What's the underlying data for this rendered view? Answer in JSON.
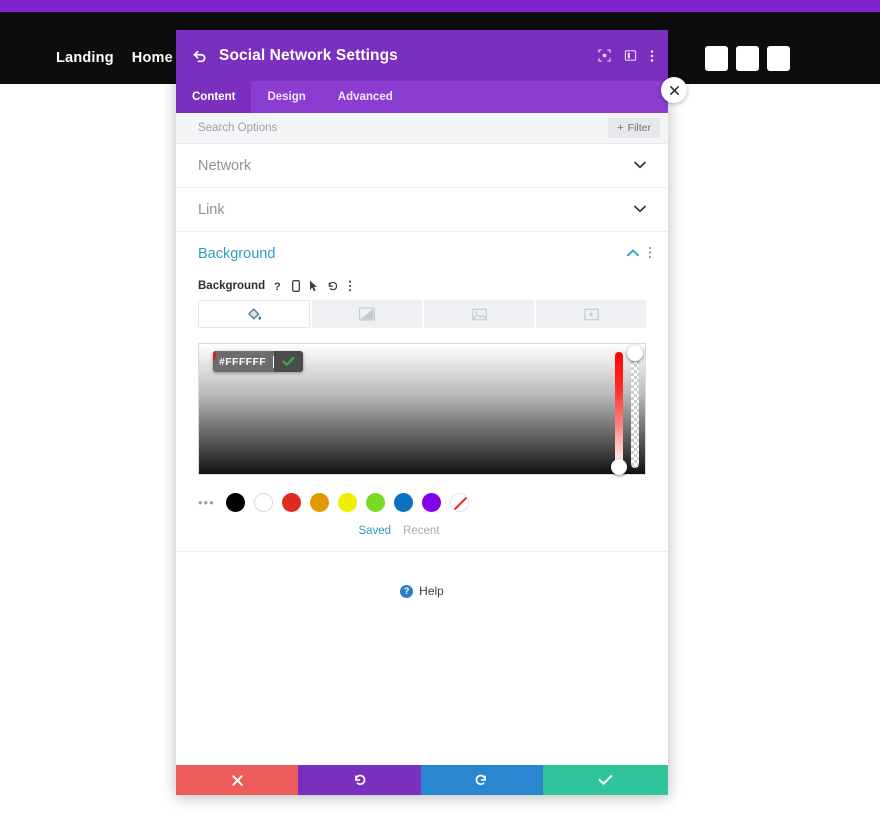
{
  "page": {
    "nav_links": [
      {
        "label": "Landing"
      },
      {
        "label": "Home"
      }
    ],
    "social_placeholder_count": 3,
    "topstrip_color": "#7e22ce",
    "nav_bg_color": "#0d0d0f"
  },
  "modal": {
    "title": "Social Network Settings",
    "back_icon": "back-arrow-icon",
    "header_icons": [
      "expand-icon",
      "split-view-icon",
      "kebab-menu-icon"
    ],
    "header_color": "#7b2fbe",
    "tabs": [
      {
        "label": "Content",
        "active": true
      },
      {
        "label": "Design",
        "active": false
      },
      {
        "label": "Advanced",
        "active": false
      }
    ],
    "search": {
      "placeholder": "Search Options",
      "value": ""
    },
    "filter_button": {
      "label": "Filter",
      "plus": "+"
    },
    "sections": [
      {
        "label": "Network",
        "expanded": false,
        "chevron": "⌄"
      },
      {
        "label": "Link",
        "expanded": false,
        "chevron": "⌄"
      }
    ],
    "background_section": {
      "label": "Background",
      "expanded": true,
      "chevron_up": "⌃",
      "kebab": "⋮",
      "accent_color": "#2e9ebd",
      "control_label": "Background",
      "control_icons": [
        "help-icon",
        "responsive-device-icon",
        "hover-cursor-icon",
        "reset-icon",
        "kebab-menu-icon"
      ],
      "type_tabs": [
        {
          "name": "background-color-tab",
          "icon": "paint-bucket-icon",
          "active": true
        },
        {
          "name": "background-gradient-tab",
          "icon": "gradient-icon",
          "active": false
        },
        {
          "name": "background-image-tab",
          "icon": "image-icon",
          "active": false
        },
        {
          "name": "background-video-tab",
          "icon": "video-icon",
          "active": false
        }
      ],
      "color_picker": {
        "hex_value": "#FFFFFF",
        "confirm_icon": "check-icon",
        "badge": "1",
        "badge_color": "#e01b1b",
        "hue_handle_position": "bottom",
        "alpha_handle_position": "top"
      },
      "swatches": {
        "more_icon": "•••",
        "colors": [
          {
            "name": "swatch-black",
            "hex": "#000000"
          },
          {
            "name": "swatch-white",
            "hex": "#FFFFFF"
          },
          {
            "name": "swatch-red",
            "hex": "#E02B20"
          },
          {
            "name": "swatch-orange",
            "hex": "#E09900"
          },
          {
            "name": "swatch-yellow",
            "hex": "#EDF000"
          },
          {
            "name": "swatch-green",
            "hex": "#7CDA24"
          },
          {
            "name": "swatch-blue",
            "hex": "#0C71C3"
          },
          {
            "name": "swatch-purple",
            "hex": "#8300E9"
          },
          {
            "name": "swatch-none",
            "hex": "transparent"
          }
        ],
        "tabs": [
          {
            "label": "Saved",
            "active": true
          },
          {
            "label": "Recent",
            "active": false
          }
        ]
      }
    },
    "help": {
      "label": "Help",
      "icon_char": "?"
    },
    "footer_buttons": [
      {
        "name": "cancel-button",
        "icon": "✖",
        "color": "#ed5b5b"
      },
      {
        "name": "undo-button",
        "icon": "↺",
        "color": "#7b2fbe"
      },
      {
        "name": "redo-button",
        "icon": "↻",
        "color": "#2a86cf"
      },
      {
        "name": "save-button",
        "icon": "✔",
        "color": "#2fc49a"
      }
    ],
    "close_button": {
      "icon": "✕"
    }
  }
}
